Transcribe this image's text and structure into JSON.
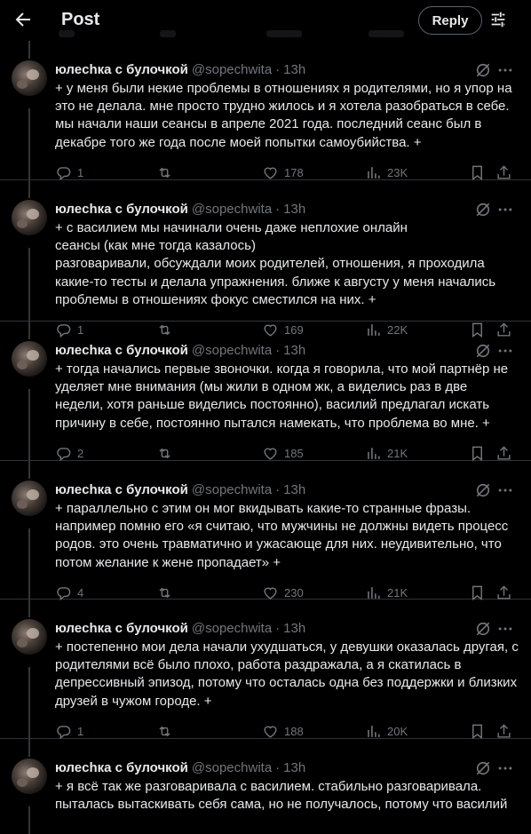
{
  "header": {
    "title": "Post",
    "reply_label": "Reply",
    "back_icon": "arrow-left-icon",
    "settings_icon": "sliders-icon"
  },
  "author": {
    "name": "юлеchка с булочкой",
    "handle": "@sopechwita",
    "separator": "·"
  },
  "tweets": [
    {
      "time": "13h",
      "text": "+ у меня были некие проблемы в отношениях я родителями, но я упор на это не делала. мне просто трудно жилось и я хотела разобраться в себе. мы начали наши сеансы в апреле 2021 года. последний сеанс был в декабре того же года после моей попытки самоубийства. +",
      "replies": "1",
      "retweets": "",
      "likes": "178",
      "views": "23K"
    },
    {
      "time": "13h",
      "text": "+ с василием мы начинали очень даже неплохие онлайн\nсеансы (как мне тогда казалось)\nразговаривали, обсуждали моих родителей, отношения, я проходила какие-то тесты и делала упражнения. ближе к августу у меня начались проблемы в отношениях фокус сместился на них. +",
      "replies": "1",
      "retweets": "",
      "likes": "169",
      "views": "22K"
    },
    {
      "time": "13h",
      "text": "+ тогда начались первые звоночки. когда я говорила, что мой партнёр не уделяет мне внимания (мы жили в одном жк, а виделись раз в две недели, хотя раньше виделись постоянно), василий предлагал искать причину в себе, постоянно пытался намекать, что проблема во мне. +",
      "replies": "2",
      "retweets": "",
      "likes": "185",
      "views": "21K"
    },
    {
      "time": "13h",
      "text": "+ параллельно с этим он мог вкидывать какие-то странные фразы. например помню его «я считаю, что мужчины не должны видеть процесс родов. это очень травматично и ужасающе для них. неудивительно, что потом желание к жене пропадает» +",
      "replies": "4",
      "retweets": "",
      "likes": "230",
      "views": "21K"
    },
    {
      "time": "13h",
      "text": "+ постепенно мои дела начали ухудшаться, у девушки оказалась другая, с родителями всё было плохо, работа раздражала, а я скатилась в депрессивный эпизод, потому что осталась одна без поддержки и близких друзей в чужом городе. +",
      "replies": "1",
      "retweets": "",
      "likes": "188",
      "views": "20K"
    },
    {
      "time": "13h",
      "text": "+ я всё так же разговаривала с василием. стабильно разговаривала. пыталась вытаскивать себя сама, но не получалось, потому что василий",
      "replies": "",
      "retweets": "",
      "likes": "",
      "views": ""
    }
  ]
}
